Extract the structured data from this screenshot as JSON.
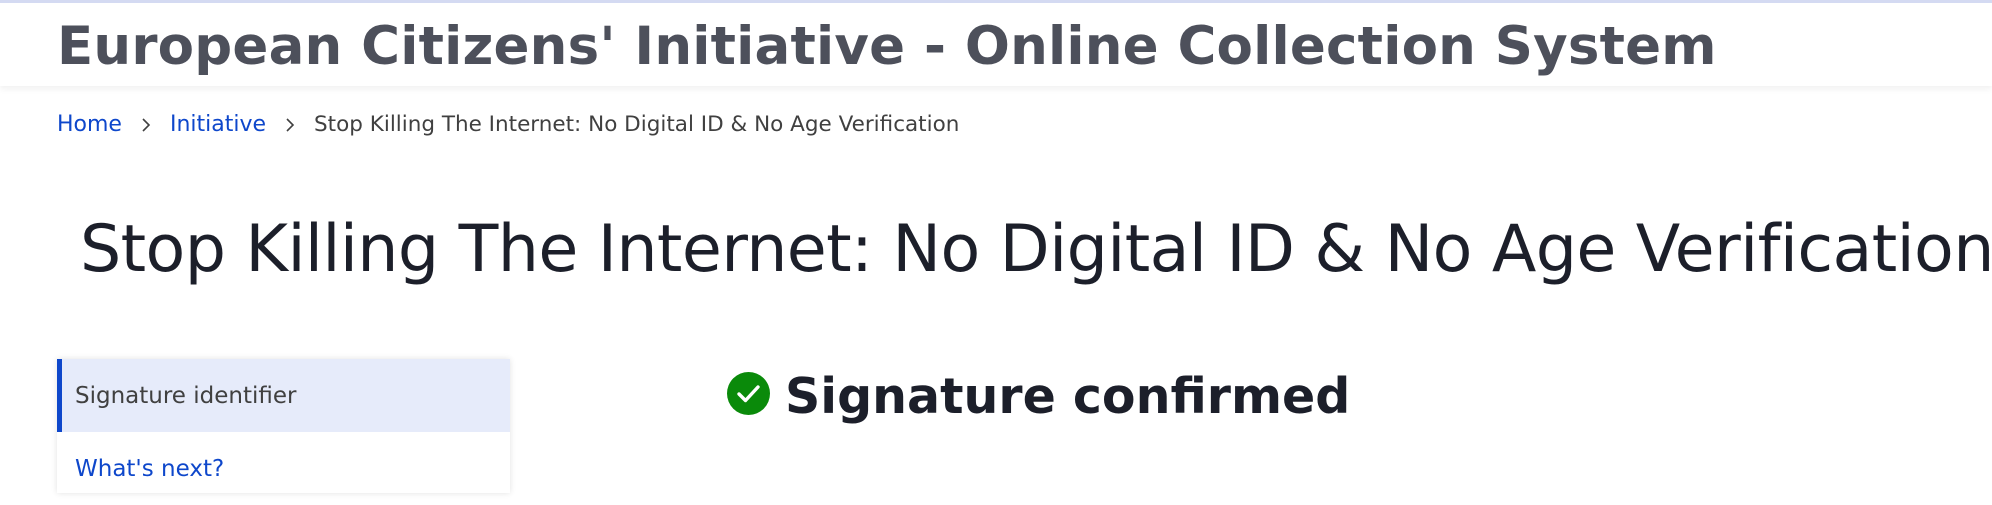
{
  "header": {
    "title": "European Citizens' Initiative - Online Collection System"
  },
  "breadcrumb": {
    "items": [
      {
        "label": "Home"
      },
      {
        "label": "Initiative"
      },
      {
        "label": "Stop Killing The Internet: No Digital ID & No Age Verification"
      }
    ]
  },
  "page": {
    "title": "Stop Killing The Internet: No Digital ID & No Age Verification"
  },
  "side_nav": {
    "items": [
      {
        "label": "Signature identifier",
        "active": true
      },
      {
        "label": "What's next?",
        "active": false
      }
    ]
  },
  "status": {
    "icon": "check-circle-icon",
    "heading": "Signature confirmed",
    "color": "#0a8a0a"
  },
  "colors": {
    "accent": "#0e47cb",
    "header_text": "#4d505b",
    "active_bg": "#e6ebfa",
    "success": "#0a8a0a"
  }
}
